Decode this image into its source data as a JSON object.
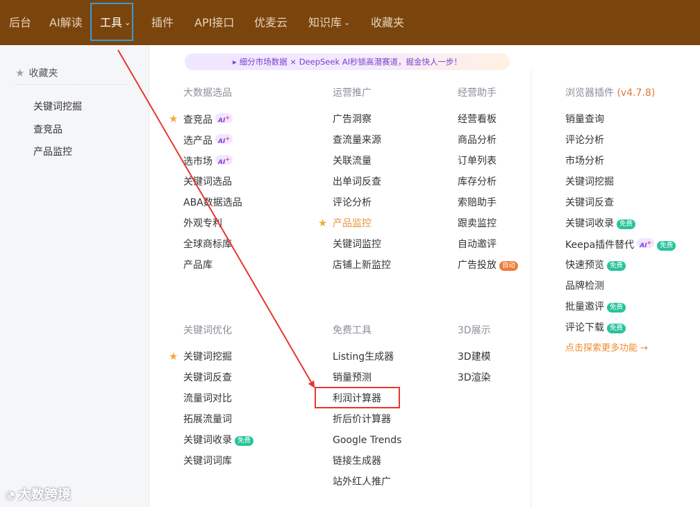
{
  "nav": {
    "items": [
      "后台",
      "AI解读",
      "工具",
      "插件",
      "API接口",
      "优麦云",
      "知识库",
      "收藏夹"
    ],
    "caret": "⌄"
  },
  "sidebar": {
    "heading": "收藏夹",
    "items": [
      "关键词挖掘",
      "查竞品",
      "产品监控"
    ]
  },
  "banner": {
    "text": "细分市场数据 × DeepSeek AI秒锁高潜赛道，掘金快人一步！"
  },
  "sections": {
    "bigdata": {
      "title": "大数据选品",
      "items": [
        "查竞品",
        "选产品",
        "选市场",
        "关键词选品",
        "ABA数据选品",
        "外观专利",
        "全球商标库",
        "产品库"
      ]
    },
    "promo": {
      "title": "运营推广",
      "items": [
        "广告洞察",
        "查流量来源",
        "关联流量",
        "出单词反查",
        "评论分析",
        "产品监控",
        "关键词监控",
        "店铺上新监控"
      ]
    },
    "ops": {
      "title": "经营助手",
      "items": [
        "经营看板",
        "商品分析",
        "订单列表",
        "库存分析",
        "索赔助手",
        "跟卖监控",
        "自动邀评",
        "广告投放"
      ]
    },
    "browser": {
      "title": "浏览器插件",
      "version": "(v4.7.8)",
      "items": [
        "销量查询",
        "评论分析",
        "市场分析",
        "关键词挖掘",
        "关键词反查",
        "关键词收录",
        "Keepa插件替代",
        "快速预览",
        "品牌检测",
        "批量邀评",
        "评论下载"
      ],
      "explore": "点击探索更多功能 →"
    },
    "keyword": {
      "title": "关键词优化",
      "items": [
        "关键词挖掘",
        "关键词反查",
        "流量词对比",
        "拓展流量词",
        "关键词收录",
        "关键词词库"
      ]
    },
    "free": {
      "title": "免费工具",
      "items": [
        "Listing生成器",
        "销量预测",
        "利润计算器",
        "折后价计算器",
        "Google Trends",
        "链接生成器",
        "站外红人推广"
      ]
    },
    "show3d": {
      "title": "3D展示",
      "items": [
        "3D建模",
        "3D渲染"
      ]
    }
  },
  "badges": {
    "ai": "AI",
    "ai_spark": "+",
    "free": "免费",
    "auto": "自动"
  },
  "icons": {
    "star": "★",
    "megaphone": "📢"
  },
  "colors": {
    "nav_bg": "#7a450c",
    "highlight_blue": "#3a9ad9",
    "annotation_red": "#e8352c",
    "favorite_star": "#f2a93b",
    "free_badge": "#27c39a",
    "auto_badge": "#ee7a3a"
  },
  "watermark": {
    "text": "大数跨境"
  }
}
